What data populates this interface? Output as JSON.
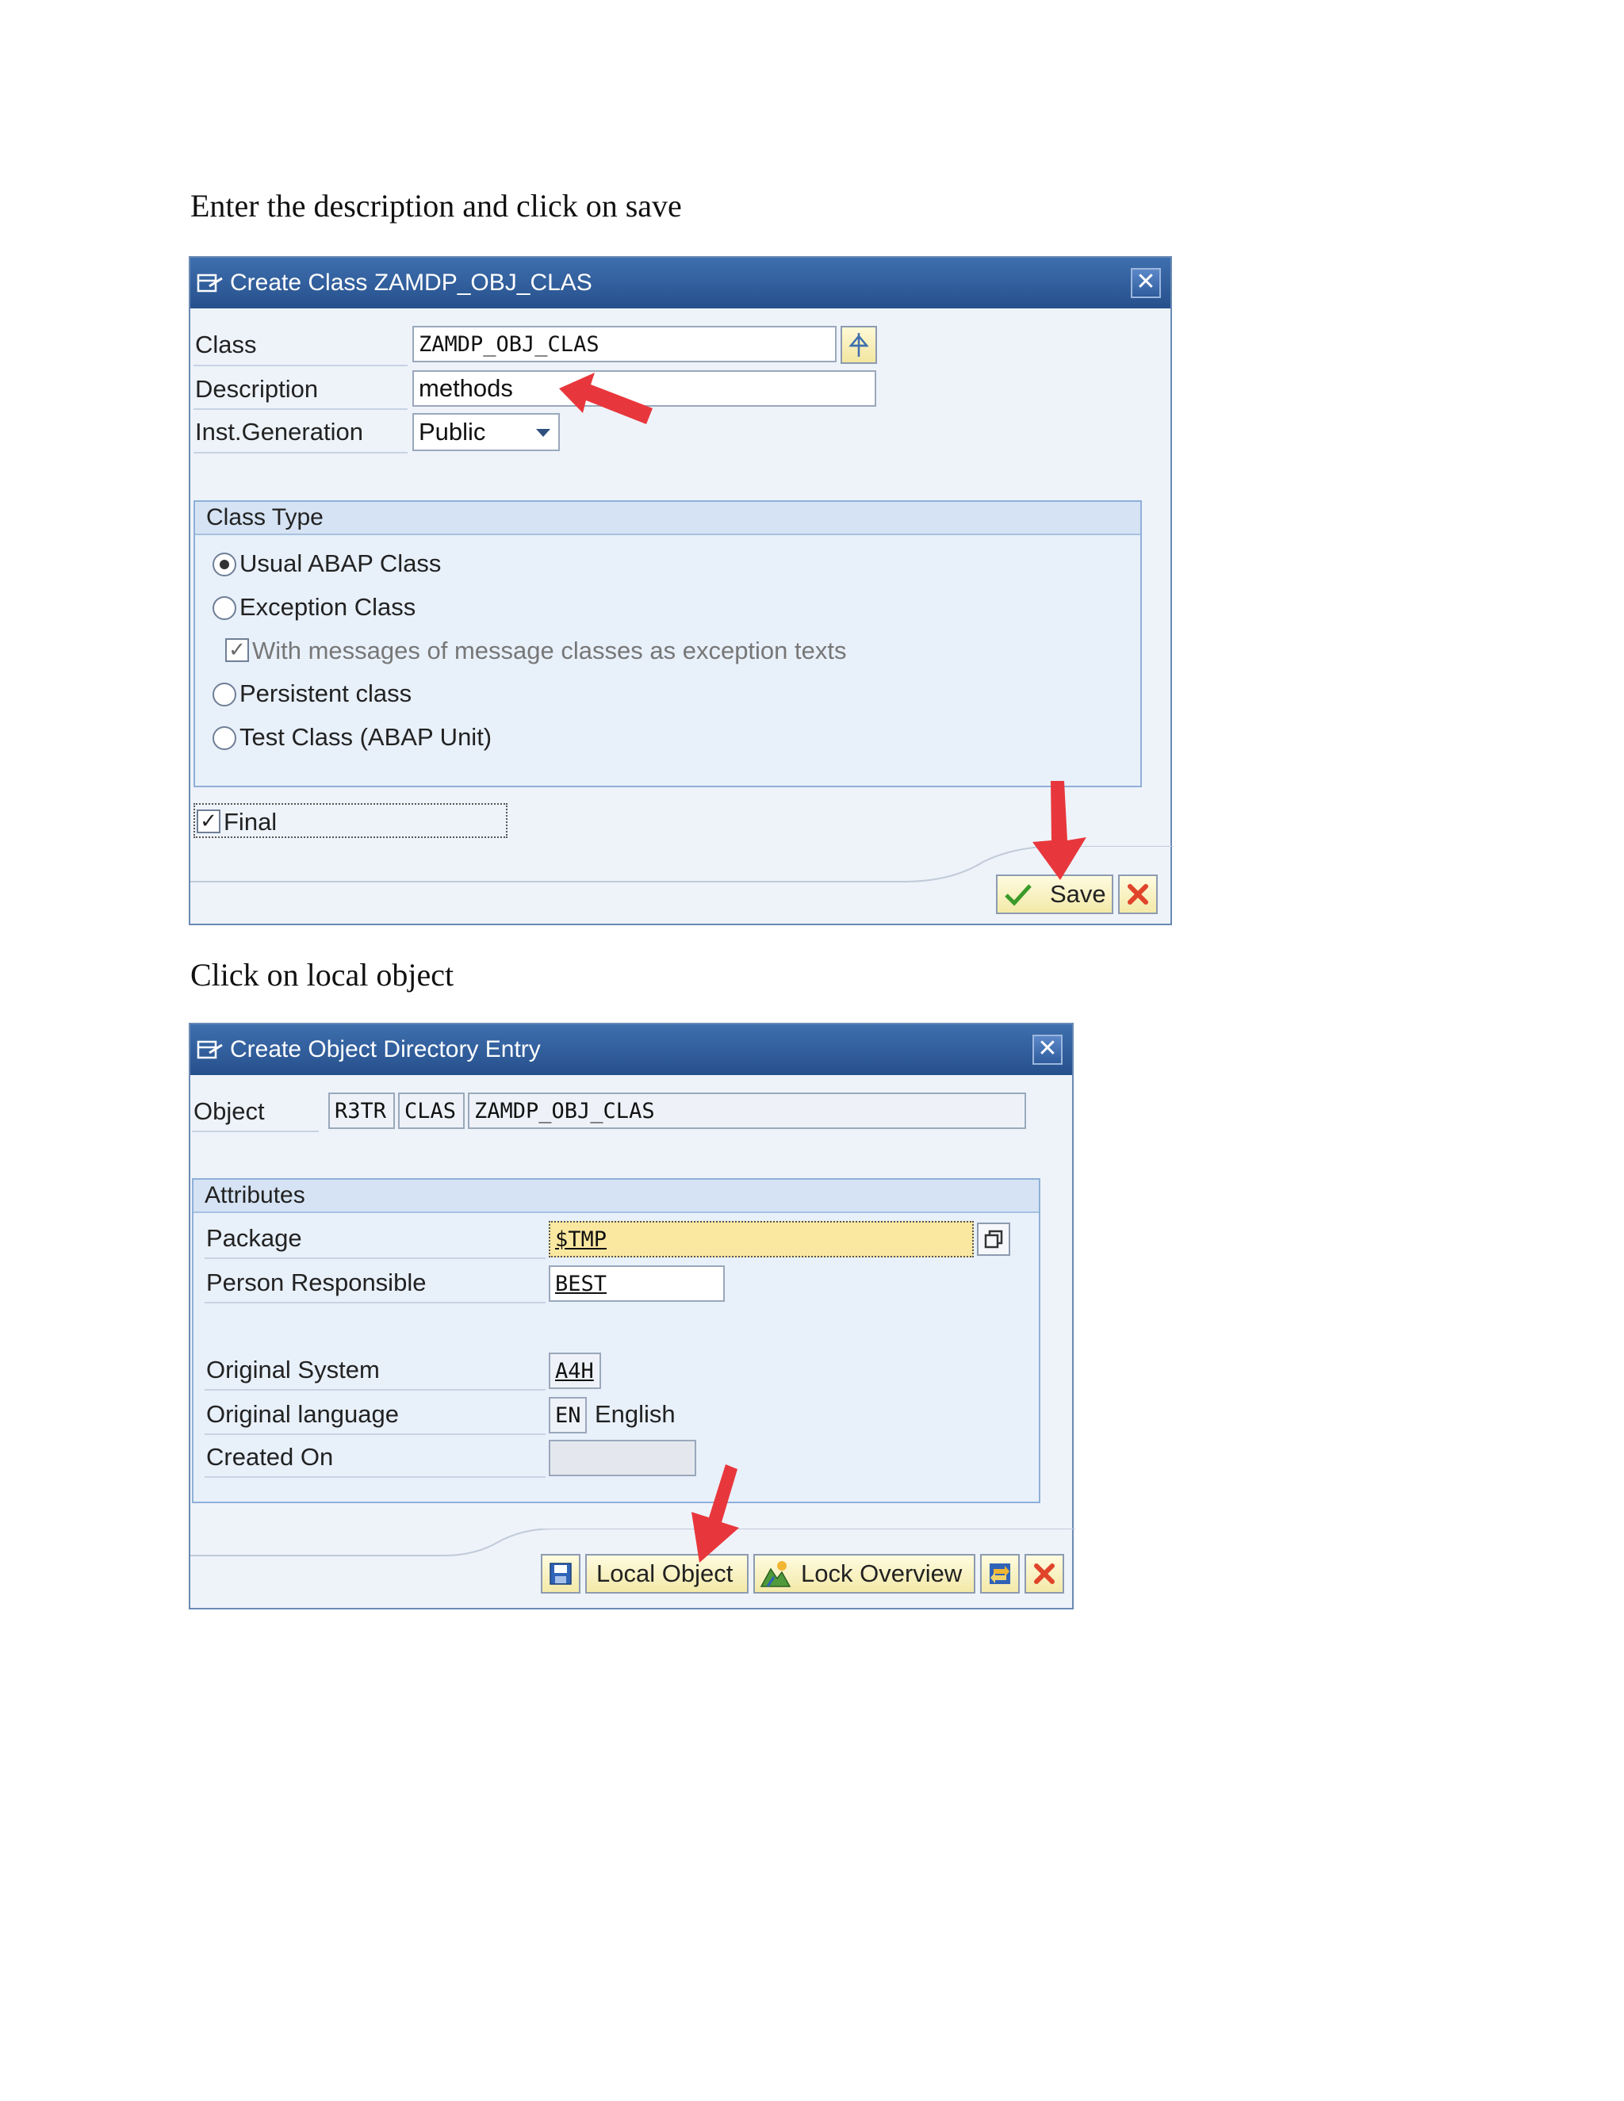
{
  "instructions": {
    "step1": "Enter the description and click on save",
    "step2": "Click on local object"
  },
  "create_class_dialog": {
    "title": "Create Class ZAMDP_OBJ_CLAS",
    "close_symbol": "✕",
    "fields": {
      "class_label": "Class",
      "class_value": "ZAMDP_OBJ_CLAS",
      "description_label": "Description",
      "description_value": "methods",
      "inst_generation_label": "Inst.Generation",
      "inst_generation_value": "Public"
    },
    "class_type_group": {
      "title": "Class Type",
      "options": [
        {
          "label": "Usual ABAP Class",
          "selected": true
        },
        {
          "label": "Exception Class",
          "selected": false
        },
        {
          "label": "With messages of message classes as exception texts",
          "checked": true,
          "disabled": true
        },
        {
          "label": "Persistent class",
          "selected": false
        },
        {
          "label": "Test Class (ABAP Unit)",
          "selected": false
        }
      ]
    },
    "final_checkbox": {
      "label": "Final",
      "checked": true
    },
    "buttons": {
      "save_label": "Save",
      "cancel_icon": "cancel-icon"
    }
  },
  "object_directory_dialog": {
    "title": "Create Object Directory Entry",
    "close_symbol": "✕",
    "object_label": "Object",
    "object_values": [
      "R3TR",
      "CLAS",
      "ZAMDP_OBJ_CLAS"
    ],
    "attributes_group": {
      "title": "Attributes",
      "package_label": "Package",
      "package_value": "$TMP",
      "person_label": "Person Responsible",
      "person_value": "BEST",
      "original_system_label": "Original System",
      "original_system_value": "A4H",
      "original_language_label": "Original language",
      "original_language_code": "EN",
      "original_language_name": "English",
      "created_on_label": "Created On",
      "created_on_value": ""
    },
    "buttons": {
      "save_icon": "save-icon",
      "local_object_label": "Local Object",
      "lock_overview_label": "Lock Overview",
      "transport_icon": "transport-icon",
      "cancel_icon": "cancel-icon"
    }
  },
  "annotation_arrow_color": "#e8373c"
}
